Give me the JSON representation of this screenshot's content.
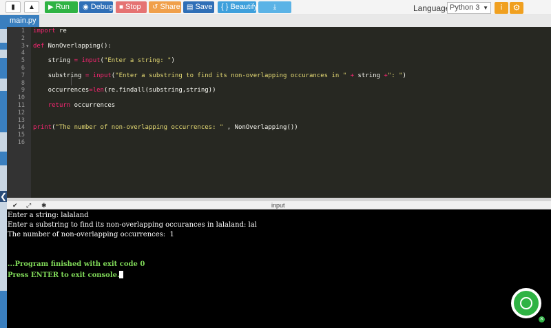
{
  "toolbar": {
    "run_label": "Run",
    "debug_label": "Debug",
    "stop_label": "Stop",
    "share_label": "Share",
    "save_label": "Save",
    "beautify_label": "{ } Beautify",
    "language_label": "Language",
    "language_value": "Python 3"
  },
  "tabs": {
    "main": "main.py"
  },
  "editor": {
    "line_numbers": [
      "1",
      "2",
      "3",
      "4",
      "5",
      "6",
      "7",
      "8",
      "9",
      "10",
      "11",
      "12",
      "13",
      "14",
      "15",
      "16"
    ],
    "lines": [
      "import re",
      "",
      "def NonOverlapping():",
      "",
      "    string = input(\"Enter a string: \")",
      "",
      "    substring = input(\"Enter a substring to find its non-overlapping occurances in \" + string +\": \")",
      "",
      "    occurrences=len(re.findall(substring,string))",
      "",
      "    return occurrences",
      "",
      "",
      "print(\"The number of non-overlapping occurrences: \" , NonOverlapping())",
      "",
      ""
    ]
  },
  "io": {
    "title": "input"
  },
  "console": {
    "lines": [
      "Enter a string: lalaland",
      "Enter a substring to find its non-overlapping occurances in lalaland: lal",
      "The number of non-overlapping occurrences:  1"
    ],
    "exit_message": "...Program finished with exit code 0",
    "prompt": "Press ENTER to exit console."
  },
  "colors": {
    "run": "#2fb344",
    "debug": "#2f6fb7",
    "stop": "#e57373",
    "share": "#f0a04b",
    "editor_bg": "#272822",
    "console_bg": "#000000",
    "console_green": "#7fd858"
  },
  "icons": [
    "file-icon",
    "upload-icon",
    "play-icon",
    "debug-icon",
    "stop-icon",
    "share-icon",
    "save-icon",
    "download-icon",
    "info-icon",
    "gear-icon",
    "collapse-icon",
    "expand-icon",
    "debug-bug-icon",
    "chat-icon"
  ]
}
